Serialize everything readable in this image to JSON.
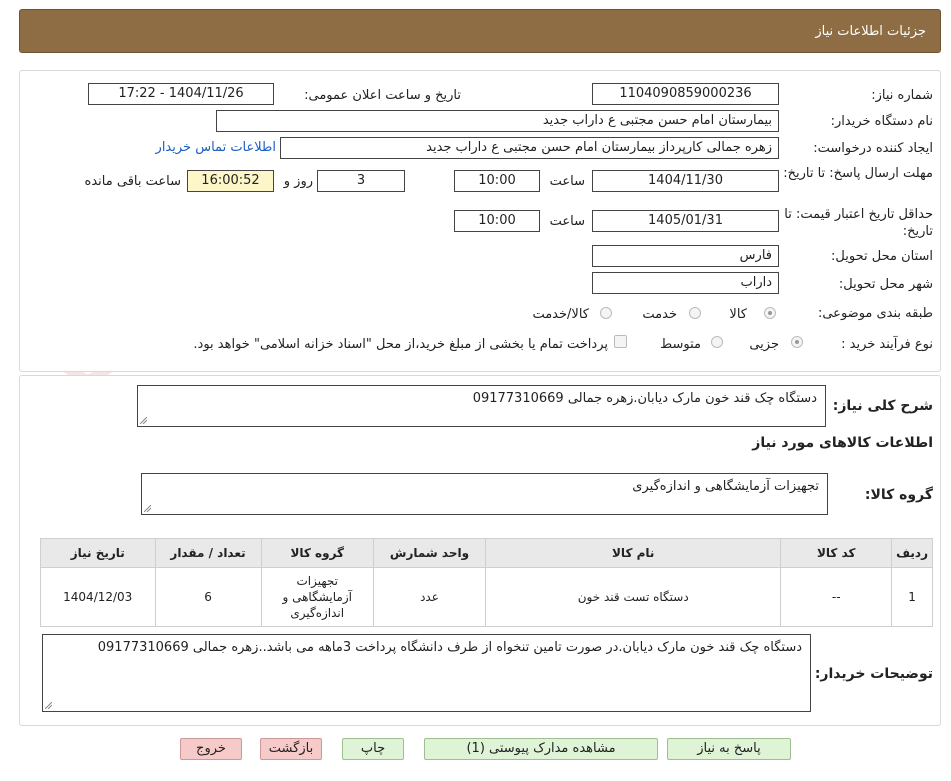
{
  "header": {
    "title": "جزئیات اطلاعات نیاز"
  },
  "form": {
    "need_number_label": "شماره نیاز:",
    "need_number": "1104090859000236",
    "announce_label": "تاریخ و ساعت اعلان عمومی:",
    "announce_value": "1404/11/26 - 17:22",
    "buyer_org_label": "نام دستگاه خریدار:",
    "buyer_org": "بیمارستان امام حسن مجتبی  ع  داراب جدید",
    "requester_label": "ایجاد کننده درخواست:",
    "requester": "زهره جمالی کارپرداز بیمارستان امام حسن مجتبی  ع  داراب جدید",
    "buyer_contact_link": "اطلاعات تماس خریدار",
    "deadline_label": "مهلت ارسال پاسخ: تا تاریخ:",
    "deadline_date": "1404/11/30",
    "time_label": "ساعت",
    "deadline_time": "10:00",
    "days_value": "3",
    "days_label": "روز و",
    "remaining_time": "16:00:52",
    "remaining_label": "ساعت باقی مانده",
    "validity_label": "حداقل تاریخ اعتبار قیمت: تا تاریخ:",
    "validity_date": "1405/01/31",
    "validity_time": "10:00",
    "province_label": "استان محل تحویل:",
    "province": "فارس",
    "city_label": "شهر محل تحویل:",
    "city": "داراب",
    "category_label": "طبقه بندی موضوعی:",
    "category_options": [
      "کالا",
      "خدمت",
      "کالا/خدمت"
    ],
    "process_label": "نوع فرآیند خرید :",
    "process_options": [
      "جزیی",
      "متوسط"
    ],
    "payment_note": "پرداخت تمام یا بخشی از مبلغ خرید،از محل \"اسناد خزانه اسلامی\" خواهد بود."
  },
  "details": {
    "summary_label": "شرح کلی نیاز:",
    "summary": "دستگاه چک قند خون مارک دیابان.زهره جمالی 09177310669",
    "goods_info_title": "اطلاعات کالاهای مورد نیاز",
    "goods_group_label": "گروه کالا:",
    "goods_group": "تجهیزات آزمایشگاهی و اندازه‌گیری",
    "table_headers": [
      "ردیف",
      "کد کالا",
      "نام کالا",
      "واحد شمارش",
      "گروه کالا",
      "تعداد / مقدار",
      "تاریخ نیاز"
    ],
    "table_rows": [
      [
        "1",
        "--",
        "دستگاه تست قند خون",
        "عدد",
        "تجهیزات آزمایشگاهی و اندازه‌گیری",
        "6",
        "1404/12/03"
      ]
    ],
    "buyer_notes_label": "توضیحات خریدار:",
    "buyer_notes": "دستگاه چک قند خون مارک  دیابان.در صورت تامین تنخواه از طرف دانشگاه پرداخت 3ماهه می باشد..زهره جمالی 09177310669"
  },
  "buttons": {
    "reply": "پاسخ به نیاز",
    "attachments": "مشاهده مدارک پیوستی (1)",
    "print": "چاپ",
    "back": "بازگشت",
    "exit": "خروج"
  },
  "watermark": {
    "text": "AriaTender.neT"
  },
  "colors": {
    "header_bg": "#8e6c44",
    "link": "#1a5ec6",
    "green_btn": "#dff3d6",
    "red_btn": "#f7caca",
    "highlight": "#fdf6c9"
  }
}
